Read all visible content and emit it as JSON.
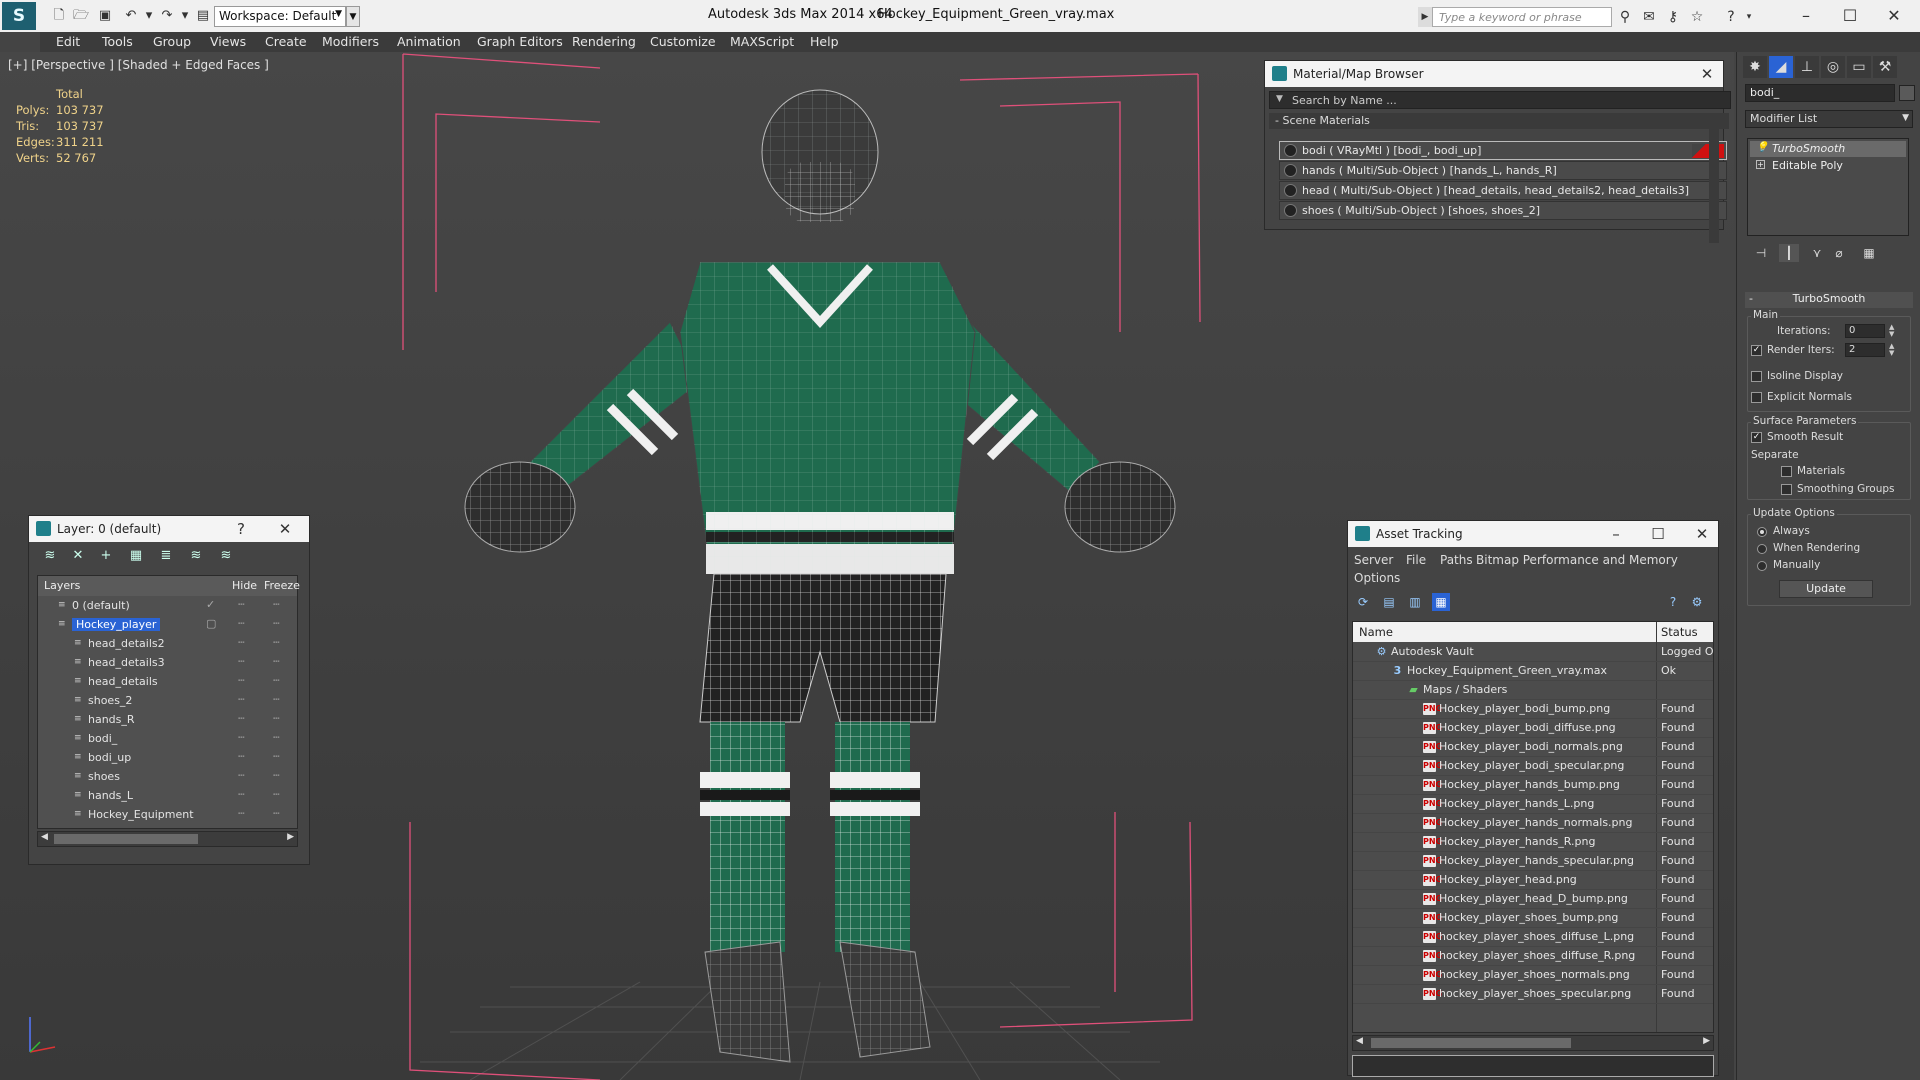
{
  "titlebar": {
    "logo": "S",
    "workspace": "Workspace: Default",
    "app_title": "Autodesk 3ds Max  2014 x64",
    "file_title": "Hockey_Equipment_Green_vray.max",
    "search_placeholder": "Type a keyword or phrase"
  },
  "menu": [
    "Edit",
    "Tools",
    "Group",
    "Views",
    "Create",
    "Modifiers",
    "Animation",
    "Graph Editors",
    "Rendering",
    "Customize",
    "MAXScript",
    "Help"
  ],
  "viewport": {
    "label": "[+] [Perspective ] [Shaded + Edged Faces ]",
    "stats": {
      "header": "Total",
      "rows": [
        {
          "label": "Polys:",
          "value": "103 737"
        },
        {
          "label": "Tris:",
          "value": "103 737"
        },
        {
          "label": "Edges:",
          "value": "311 211"
        },
        {
          "label": "Verts:",
          "value": "52 767"
        }
      ]
    }
  },
  "material_browser": {
    "title": "Material/Map Browser",
    "search_placeholder": "Search by Name ...",
    "section": "- Scene Materials",
    "items": [
      {
        "text": "bodi  ( VRayMtl ) [bodi_, bodi_up]"
      },
      {
        "text": "hands  ( Multi/Sub-Object ) [hands_L, hands_R]"
      },
      {
        "text": "head  ( Multi/Sub-Object ) [head_details, head_details2, head_details3]"
      },
      {
        "text": "shoes  ( Multi/Sub-Object ) [shoes, shoes_2]"
      }
    ]
  },
  "layers": {
    "title": "Layer: 0 (default)",
    "help": "?",
    "columns": {
      "layers": "Layers",
      "hide": "Hide",
      "freeze": "Freeze"
    },
    "rows": [
      {
        "name": "0 (default)",
        "indent": 0
      },
      {
        "name": "Hockey_player",
        "indent": 0
      },
      {
        "name": "head_details2",
        "indent": 1
      },
      {
        "name": "head_details3",
        "indent": 1
      },
      {
        "name": "head_details",
        "indent": 1
      },
      {
        "name": "shoes_2",
        "indent": 1
      },
      {
        "name": "hands_R",
        "indent": 1
      },
      {
        "name": "bodi_",
        "indent": 1
      },
      {
        "name": "bodi_up",
        "indent": 1
      },
      {
        "name": "shoes",
        "indent": 1
      },
      {
        "name": "hands_L",
        "indent": 1
      },
      {
        "name": "Hockey_Equipment",
        "indent": 1
      }
    ]
  },
  "asset_tracking": {
    "title": "Asset Tracking",
    "menu": [
      "Server",
      "File",
      "Paths",
      "Bitmap Performance and Memory"
    ],
    "menu2": "Options",
    "columns": {
      "name": "Name",
      "status": "Status"
    },
    "rows": [
      {
        "name": "Autodesk Vault",
        "status": "Logged Ou",
        "level": 0,
        "icon": "vault"
      },
      {
        "name": "Hockey_Equipment_Green_vray.max",
        "status": "Ok",
        "level": 1,
        "icon": "max"
      },
      {
        "name": "Maps / Shaders",
        "status": "",
        "level": 2,
        "icon": "maps"
      },
      {
        "name": "Hockey_player_bodi_bump.png",
        "status": "Found",
        "level": 3,
        "icon": "png"
      },
      {
        "name": "Hockey_player_bodi_diffuse.png",
        "status": "Found",
        "level": 3,
        "icon": "png"
      },
      {
        "name": "Hockey_player_bodi_normals.png",
        "status": "Found",
        "level": 3,
        "icon": "png"
      },
      {
        "name": "Hockey_player_bodi_specular.png",
        "status": "Found",
        "level": 3,
        "icon": "png"
      },
      {
        "name": "Hockey_player_hands_bump.png",
        "status": "Found",
        "level": 3,
        "icon": "png"
      },
      {
        "name": "Hockey_player_hands_L.png",
        "status": "Found",
        "level": 3,
        "icon": "png"
      },
      {
        "name": "Hockey_player_hands_normals.png",
        "status": "Found",
        "level": 3,
        "icon": "png"
      },
      {
        "name": "Hockey_player_hands_R.png",
        "status": "Found",
        "level": 3,
        "icon": "png"
      },
      {
        "name": "Hockey_player_hands_specular.png",
        "status": "Found",
        "level": 3,
        "icon": "png"
      },
      {
        "name": "Hockey_player_head.png",
        "status": "Found",
        "level": 3,
        "icon": "png"
      },
      {
        "name": "Hockey_player_head_D_bump.png",
        "status": "Found",
        "level": 3,
        "icon": "png"
      },
      {
        "name": "Hockey_player_shoes_bump.png",
        "status": "Found",
        "level": 3,
        "icon": "png"
      },
      {
        "name": "hockey_player_shoes_diffuse_L.png",
        "status": "Found",
        "level": 3,
        "icon": "png"
      },
      {
        "name": "hockey_player_shoes_diffuse_R.png",
        "status": "Found",
        "level": 3,
        "icon": "png"
      },
      {
        "name": "hockey_player_shoes_normals.png",
        "status": "Found",
        "level": 3,
        "icon": "png"
      },
      {
        "name": "hockey_player_shoes_specular.png",
        "status": "Found",
        "level": 3,
        "icon": "png"
      }
    ]
  },
  "command_panel": {
    "object_name": "bodi_",
    "modifier_list": "Modifier List",
    "stack": [
      "TurboSmooth",
      "Editable Poly"
    ],
    "turbosmooth": {
      "title": "TurboSmooth",
      "main": "Main",
      "iterations_label": "Iterations:",
      "iterations": "0",
      "render_iters_label": "Render Iters:",
      "render_iters": "2",
      "isoline": "Isoline Display",
      "explicit": "Explicit Normals",
      "surface": "Surface Parameters",
      "smooth_result": "Smooth Result",
      "separate": "Separate",
      "materials": "Materials",
      "smoothing_groups": "Smoothing Groups",
      "update_options": "Update Options",
      "always": "Always",
      "when_rendering": "When Rendering",
      "manually": "Manually",
      "update": "Update"
    }
  },
  "colors": {
    "jersey": "#1f6b4e",
    "wire": "#e8e8e8",
    "gizmo": "#e0507a",
    "selection": "#2a63d4"
  }
}
